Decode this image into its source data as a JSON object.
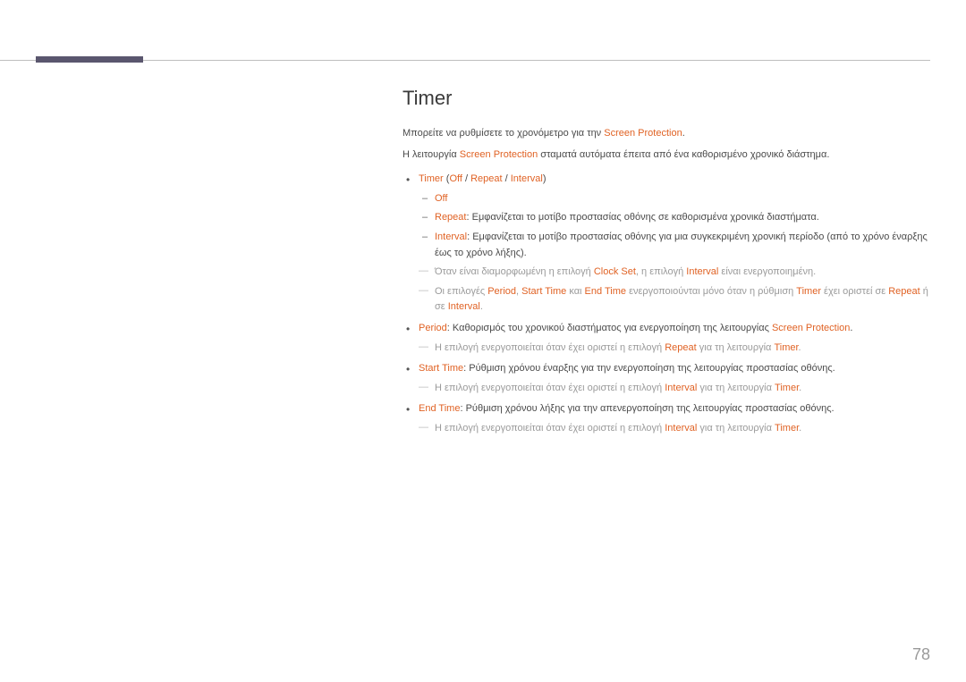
{
  "title": "Timer",
  "intro": {
    "line1_a": "Μπορείτε να ρυθμίσετε το χρονόμετρο για την ",
    "line1_b": "Screen Protection",
    "line1_c": ".",
    "line2_a": "Η λειτουργία ",
    "line2_b": "Screen Protection",
    "line2_c": " σταματά αυτόματα έπειτα από ένα καθορισμένο χρονικό διάστημα."
  },
  "timer_line": {
    "a": "Timer",
    "b": " (",
    "c": "Off",
    "d": " / ",
    "e": "Repeat",
    "f": " / ",
    "g": "Interval",
    "h": ")"
  },
  "off": "Off",
  "repeat": {
    "label": "Repeat",
    "sep": ": ",
    "text": "Εμφανίζεται το μοτίβο προστασίας οθόνης σε καθορισμένα χρονικά διαστήματα."
  },
  "interval": {
    "label": "Interval",
    "sep": ": ",
    "text": "Εμφανίζεται το μοτίβο προστασίας οθόνης για μια συγκεκριμένη χρονική περίοδο (από το χρόνο έναρξης έως το χρόνο λήξης)."
  },
  "note1": {
    "a": "Όταν είναι διαμορφωμένη η επιλογή ",
    "b": "Clock Set",
    "c": ", η επιλογή ",
    "d": "Interval",
    "e": " είναι ενεργοποιημένη."
  },
  "note2": {
    "a": "Οι επιλογές ",
    "b": "Period",
    "c": ", ",
    "d": "Start Time",
    "e": " και ",
    "f": "End Time",
    "g": " ενεργοποιούνται μόνο όταν η ρύθμιση ",
    "h": "Timer",
    "i": " έχει οριστεί σε ",
    "j": "Repeat",
    "k": " ή σε ",
    "l": "Interval",
    "m": "."
  },
  "period": {
    "label": "Period",
    "sep": ": ",
    "a": "Καθορισμός του χρονικού διαστήματος για ενεργοποίηση της λειτουργίας ",
    "b": "Screen Protection",
    "c": "."
  },
  "note3": {
    "a": "Η επιλογή ενεργοποιείται όταν έχει οριστεί η επιλογή ",
    "b": "Repeat",
    "c": " για τη λειτουργία ",
    "d": "Timer",
    "e": "."
  },
  "start": {
    "label": "Start Time",
    "sep": ": ",
    "text": "Ρύθμιση χρόνου έναρξης για την ενεργοποίηση της λειτουργίας προστασίας οθόνης."
  },
  "note4": {
    "a": "Η επιλογή ενεργοποιείται όταν έχει οριστεί η επιλογή ",
    "b": "Interval",
    "c": " για τη λειτουργία ",
    "d": "Timer",
    "e": "."
  },
  "end": {
    "label": "End Time",
    "sep": ": ",
    "text": "Ρύθμιση χρόνου λήξης για την απενεργοποίηση της λειτουργίας προστασίας οθόνης."
  },
  "note5": {
    "a": "Η επιλογή ενεργοποιείται όταν έχει οριστεί η επιλογή ",
    "b": "Interval",
    "c": " για τη λειτουργία ",
    "d": "Timer",
    "e": "."
  },
  "pagenum": "78"
}
